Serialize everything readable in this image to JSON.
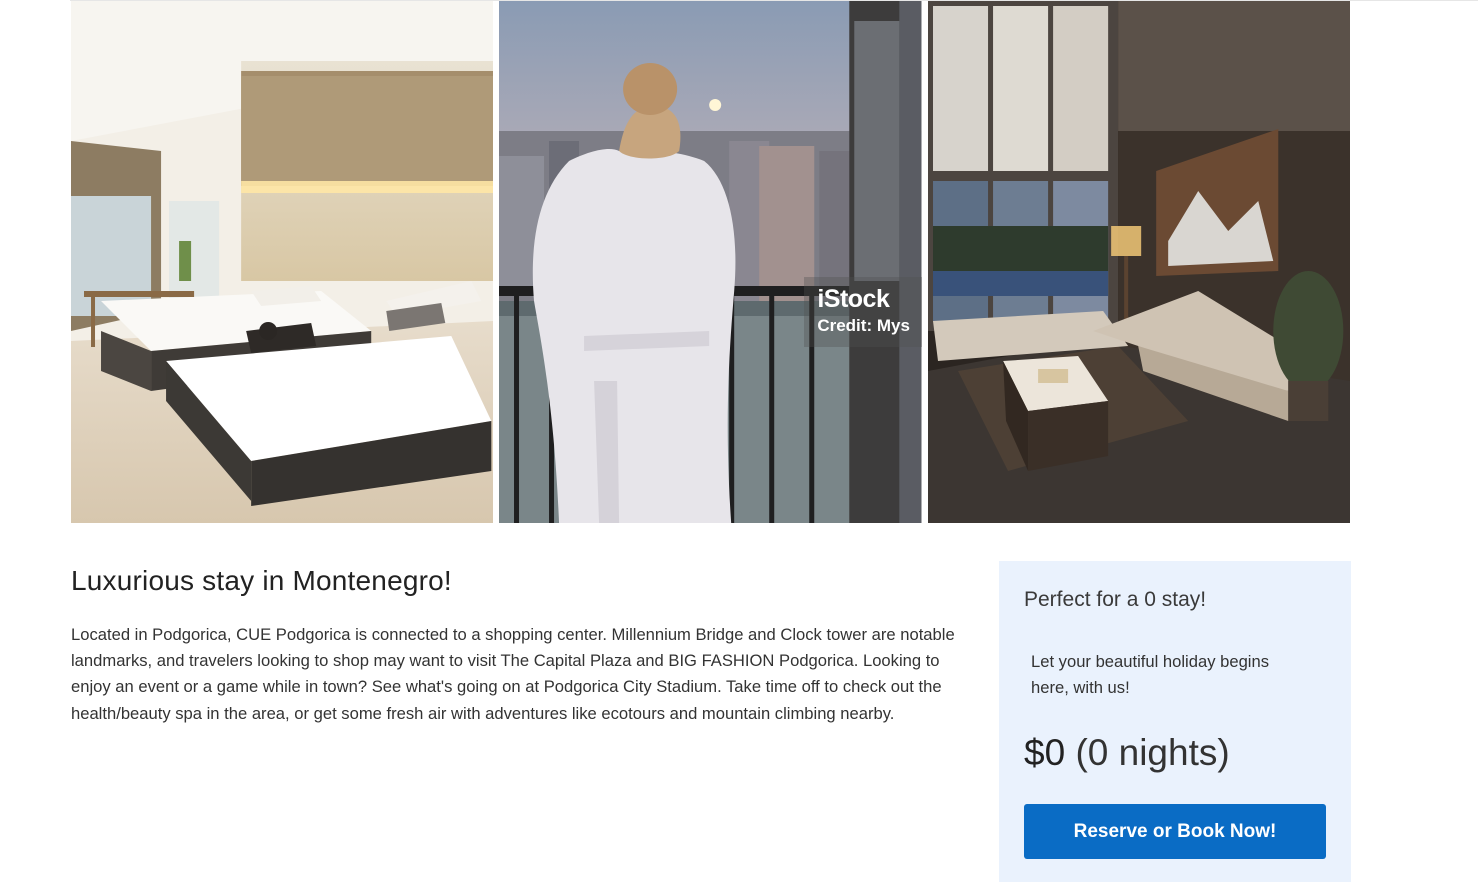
{
  "gallery": {
    "photos": [
      {
        "icon": "hotel-room-photo"
      },
      {
        "icon": "balcony-city-view-photo",
        "watermark": {
          "brand": "iStock",
          "credit": "Credit: Mys"
        }
      },
      {
        "icon": "living-room-photo"
      }
    ]
  },
  "listing": {
    "title": "Luxurious stay in Montenegro!",
    "description": "Located in Podgorica, CUE Podgorica is connected to a shopping center. Millennium Bridge and Clock tower are notable landmarks, and travelers looking to shop may want to visit The Capital Plaza and BIG FASHION Podgorica. Looking to enjoy an event or a game while in town? See what's going on at Podgorica City Stadium. Take time off to check out the health/beauty spa in the area, or get some fresh air with adventures like ecotours and mountain climbing nearby."
  },
  "booking": {
    "headline": "Perfect for a 0 stay!",
    "tagline": "Let your beautiful holiday begins here, with us!",
    "price": "$0",
    "nights": "(0 nights)",
    "button_label": "Reserve or Book Now!"
  },
  "colors": {
    "card_background": "#eaf2fd",
    "button_blue": "#0a6cc5",
    "text_dark": "#222222"
  }
}
